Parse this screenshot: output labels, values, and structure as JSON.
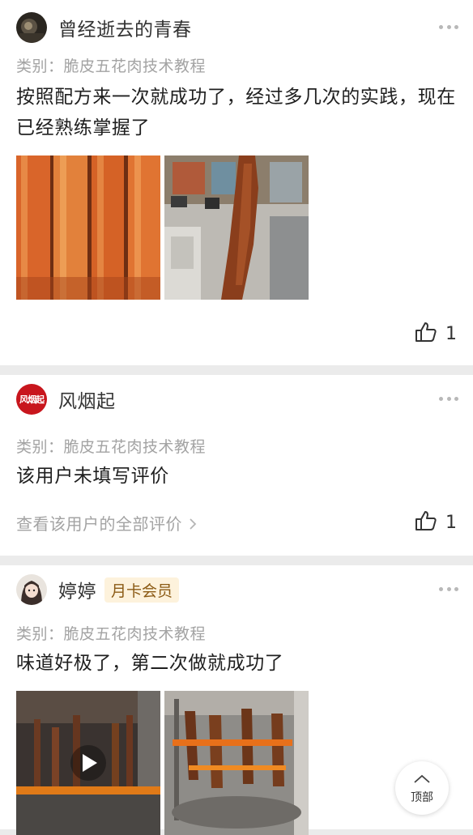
{
  "reviews": [
    {
      "username": "曾经逝去的青春",
      "category": "类别：脆皮五花肉技术教程",
      "text": "按照配方来一次就成功了，经过多几次的实践，现在已经熟练掌握了",
      "likes": "1",
      "images": [
        "crispy-pork-strips",
        "pork-hanging-street"
      ]
    },
    {
      "username": "风烟起",
      "avatar_text": "风烟起",
      "category": "类别：脆皮五花肉技术教程",
      "text": "该用户未填写评价",
      "view_all": "查看该用户的全部评价",
      "likes": "1"
    },
    {
      "username": "婷婷",
      "badge": "月卡会员",
      "category": "类别：脆皮五花肉技术教程",
      "text": "味道好极了，第二次做就成功了",
      "images": [
        "roasting-oven-video",
        "roasting-oven-pork"
      ]
    }
  ],
  "back_to_top": "顶部",
  "colors": {
    "muted": "#a3a3a3",
    "badge_bg": "#fdf2dc",
    "badge_fg": "#8b5a14",
    "avatar_red": "#c8161d"
  }
}
